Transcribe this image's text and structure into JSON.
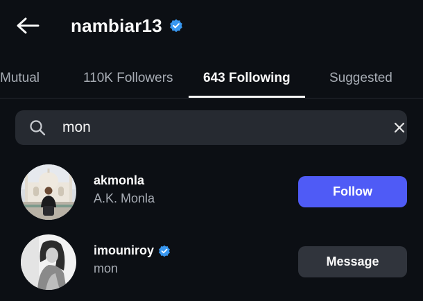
{
  "header": {
    "title": "nambiar13",
    "verified": true,
    "back_icon": "arrow-left-icon"
  },
  "tabs": [
    {
      "label": "Mutual",
      "active": false
    },
    {
      "label": "110K Followers",
      "active": false
    },
    {
      "label": "643 Following",
      "active": true
    },
    {
      "label": "Suggested",
      "active": false
    }
  ],
  "search": {
    "value": "mon",
    "icon": "search-icon",
    "clear_icon": "close-icon"
  },
  "results": [
    {
      "username": "akmonla",
      "fullname": "A.K. Monla",
      "verified": false,
      "button": "Follow"
    },
    {
      "username": "imouniroy",
      "fullname": "mon",
      "verified": true,
      "button": "Message"
    }
  ],
  "colors": {
    "accent": "#4f5bf6",
    "verified_blue": "#3897f0",
    "background": "#0c0f14"
  }
}
